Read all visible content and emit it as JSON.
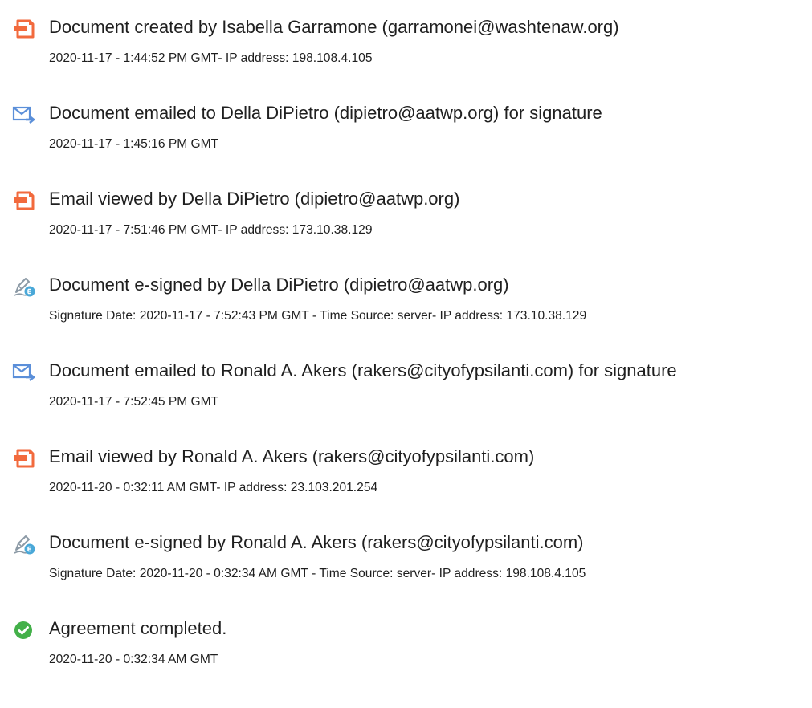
{
  "events": [
    {
      "icon": "document-icon",
      "title": "Document created by Isabella Garramone (garramonei@washtenaw.org)",
      "detail": "2020-11-17 - 1:44:52 PM GMT- IP address: 198.108.4.105"
    },
    {
      "icon": "email-sent-icon",
      "title": "Document emailed to Della DiPietro (dipietro@aatwp.org) for signature",
      "detail": "2020-11-17 - 1:45:16 PM GMT"
    },
    {
      "icon": "document-icon",
      "title": "Email viewed by Della DiPietro (dipietro@aatwp.org)",
      "detail": "2020-11-17 - 7:51:46 PM GMT- IP address: 173.10.38.129"
    },
    {
      "icon": "e-sign-pen-icon",
      "title": "Document e-signed by Della DiPietro (dipietro@aatwp.org)",
      "detail": "Signature Date: 2020-11-17 - 7:52:43 PM GMT - Time Source: server- IP address: 173.10.38.129"
    },
    {
      "icon": "email-sent-icon",
      "title": "Document emailed to Ronald A. Akers (rakers@cityofypsilanti.com) for signature",
      "detail": "2020-11-17 - 7:52:45 PM GMT"
    },
    {
      "icon": "document-icon",
      "title": "Email viewed by Ronald A. Akers (rakers@cityofypsilanti.com)",
      "detail": "2020-11-20 - 0:32:11 AM GMT- IP address: 23.103.201.254"
    },
    {
      "icon": "e-sign-pen-icon",
      "title": "Document e-signed by Ronald A. Akers (rakers@cityofypsilanti.com)",
      "detail": "Signature Date: 2020-11-20 - 0:32:34 AM GMT - Time Source: server- IP address: 198.108.4.105"
    },
    {
      "icon": "check-circle-icon",
      "title": "Agreement completed.",
      "detail": "2020-11-20 - 0:32:34 AM GMT"
    }
  ],
  "colors": {
    "document_icon": "#f26a3d",
    "email_icon": "#5b8fd9",
    "sign_pen_icon": "#8c9aa6",
    "sign_badge": "#4aa8d8",
    "check_circle": "#43b049",
    "text": "#1f1f1f"
  }
}
